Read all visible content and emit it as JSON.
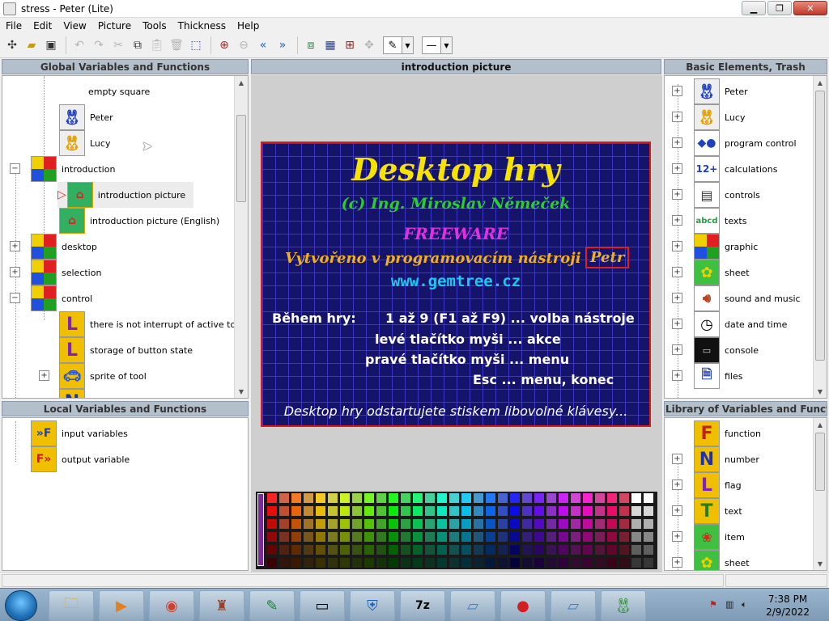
{
  "window": {
    "title": "stress - Peter (Lite)"
  },
  "menu": [
    "File",
    "Edit",
    "View",
    "Picture",
    "Tools",
    "Thickness",
    "Help"
  ],
  "panels": {
    "global_title": "Global Variables and Functions",
    "center_title": "introduction picture",
    "basic_title": "Basic Elements, Trash",
    "local_title": "Local Variables and Functions",
    "library_title": "Library of Variables and Functions"
  },
  "global_tree": [
    {
      "label": "empty square"
    },
    {
      "label": "Peter"
    },
    {
      "label": "Lucy"
    },
    {
      "label": "introduction"
    },
    {
      "label": "introduction picture"
    },
    {
      "label": "introduction picture (English)"
    },
    {
      "label": "desktop"
    },
    {
      "label": "selection"
    },
    {
      "label": "control"
    },
    {
      "label": "there is not interrupt of active tool"
    },
    {
      "label": "storage of button state"
    },
    {
      "label": "sprite of tool"
    }
  ],
  "local_tree": [
    {
      "label": "input variables"
    },
    {
      "label": "output variable"
    }
  ],
  "basic_tree": [
    {
      "label": "Peter"
    },
    {
      "label": "Lucy"
    },
    {
      "label": "program control"
    },
    {
      "label": "calculations"
    },
    {
      "label": "controls"
    },
    {
      "label": "texts"
    },
    {
      "label": "graphic"
    },
    {
      "label": "sheet"
    },
    {
      "label": "sound and music"
    },
    {
      "label": "date and time"
    },
    {
      "label": "console"
    },
    {
      "label": "files"
    }
  ],
  "library_tree": [
    {
      "label": "function"
    },
    {
      "label": "number"
    },
    {
      "label": "flag"
    },
    {
      "label": "text"
    },
    {
      "label": "item"
    },
    {
      "label": "sheet"
    }
  ],
  "intro": {
    "title": "Desktop hry",
    "author": "(c) Ing. Miroslav Němeček",
    "license": "FREEWARE",
    "created": "Vytvořeno v programovacím nástroji",
    "tool": "Petr",
    "url": "www.gemtree.cz",
    "during": "Během hry:",
    "line1": "1 až 9 (F1 až F9) ... volba nástroje",
    "line2": "levé tlačítko myši ... akce",
    "line3": "pravé tlačítko myši ... menu",
    "line4": "Esc ... menu, konec",
    "start": "Desktop hry odstartujete stiskem libovolné klávesy..."
  },
  "taskbar": {
    "time": "7:38 PM",
    "date": "2/9/2022"
  },
  "colors": {
    "intro_bg": "#15136a",
    "intro_grid": "#3a36c8",
    "title_yellow": "#f6e300",
    "author_green": "#2ad02a",
    "freeware_magenta": "#e030e0",
    "url_cyan": "#20c8f0",
    "frame_red": "#d41a1a"
  }
}
